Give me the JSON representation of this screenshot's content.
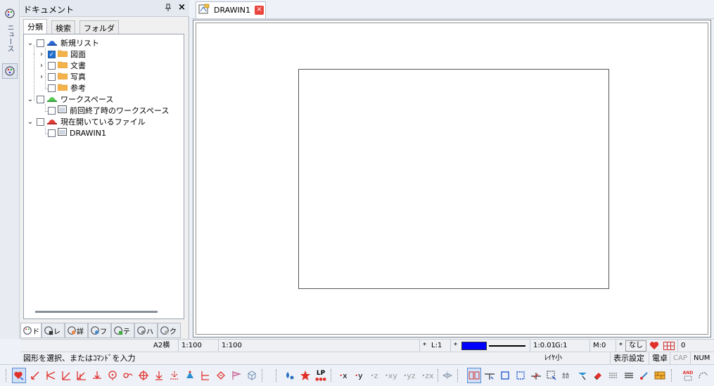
{
  "panel": {
    "title": "ドキュメント",
    "pin": "ᵖ",
    "close": "×",
    "tabs": [
      "分類",
      "検索",
      "フォルダ"
    ]
  },
  "side_strip_label": "ニュース",
  "tree": {
    "new_list": "新規リスト",
    "drawings": "図面",
    "documents": "文書",
    "photos": "写真",
    "references": "参考",
    "workspace": "ワークスペース",
    "last_workspace": "前回終了時のワークスペース",
    "open_files": "現在開いているファイル",
    "drawin1": "DRAWIN1"
  },
  "panel_bottom_tabs": [
    "ド",
    "レ",
    "詳",
    "フ",
    "テ",
    "ハ",
    "ク"
  ],
  "doc_tab": {
    "label": "DRAWIN1"
  },
  "status": {
    "paper": "A2横",
    "scale1": "1:100",
    "scale2": "1:100",
    "layer_star": "*",
    "layer": "L:1",
    "color_star": "*",
    "line_scale": "1:0.01",
    "group": "G:1",
    "mode": "M:0",
    "none_star": "*",
    "none": "なし",
    "count": "0",
    "prompt": "図形を選択、またはｺﾏﾝﾄﾞを入力",
    "layer_small": "ﾚｲﾔ小",
    "display_setting": "表示設定",
    "calculator": "電卓",
    "cap": "CAP",
    "num": "NUM"
  },
  "toolbar": {
    "lp": "LP",
    "x": "x",
    "y": "y",
    "z": "z",
    "xy": "xy",
    "yz": "yz",
    "zx": "zx",
    "and": "AND"
  },
  "colors": {
    "accent": "#1f6fcf",
    "color_swatch": "#0000ff",
    "close_red": "#e8453c",
    "tool_red": "#e0302a"
  }
}
